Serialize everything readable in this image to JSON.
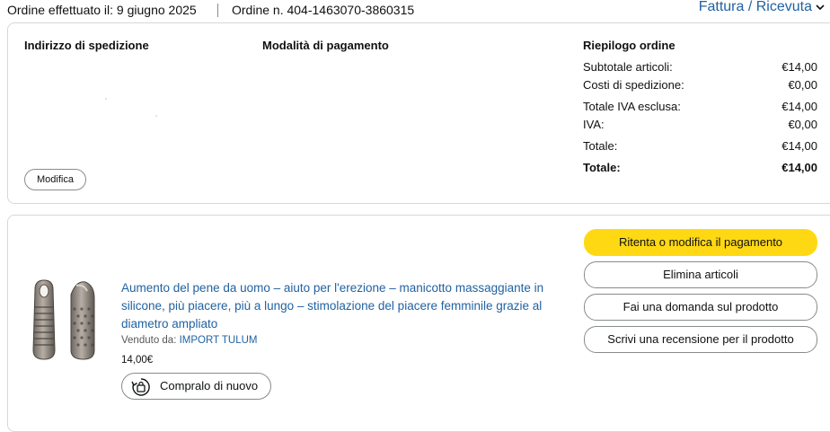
{
  "header": {
    "order_date": "Ordine effettuato il: 9 giugno 2025",
    "order_number": "Ordine n. 404-1463070-3860315",
    "invoice_link": "Fattura / Ricevuta"
  },
  "details": {
    "shipping_address_heading": "Indirizzo di spedizione",
    "payment_method_heading": "Modalità di pagamento",
    "summary_heading": "Riepilogo ordine",
    "edit_button": "Modifica",
    "summary_rows": [
      {
        "label": "Subtotale articoli:",
        "value": "€14,00"
      },
      {
        "label": "Costi di spedizione:",
        "value": "€0,00"
      },
      {
        "label": "Totale IVA esclusa:",
        "value": "€14,00"
      },
      {
        "label": "IVA:",
        "value": "€0,00"
      },
      {
        "label": "Totale:",
        "value": "€14,00"
      },
      {
        "label": "Totale:",
        "value": "€14,00"
      }
    ]
  },
  "item": {
    "title": "Aumento del pene da uomo – aiuto per l'erezione – manicotto massaggiante in silicone, più piacere, più a lungo – stimolazione del piacere femminile grazie al diametro ampliato",
    "sold_by_label": "Venduto da:",
    "seller": "IMPORT TULUM",
    "price": "14,00€",
    "buy_again_button": "Compralo di nuovo"
  },
  "actions": {
    "retry_payment": "Ritenta o modifica il pagamento",
    "delete_items": "Elimina articoli",
    "ask_question": "Fai una domanda sul prodotto",
    "write_review": "Scrivi una recensione per il prodotto"
  },
  "colors": {
    "link": "#2162a1",
    "primary_button": "#ffd814",
    "border": "#d5d9d9"
  },
  "icons": {
    "invoice_dropdown": "chevron-down-icon",
    "buy_again": "reorder-bag-icon"
  }
}
